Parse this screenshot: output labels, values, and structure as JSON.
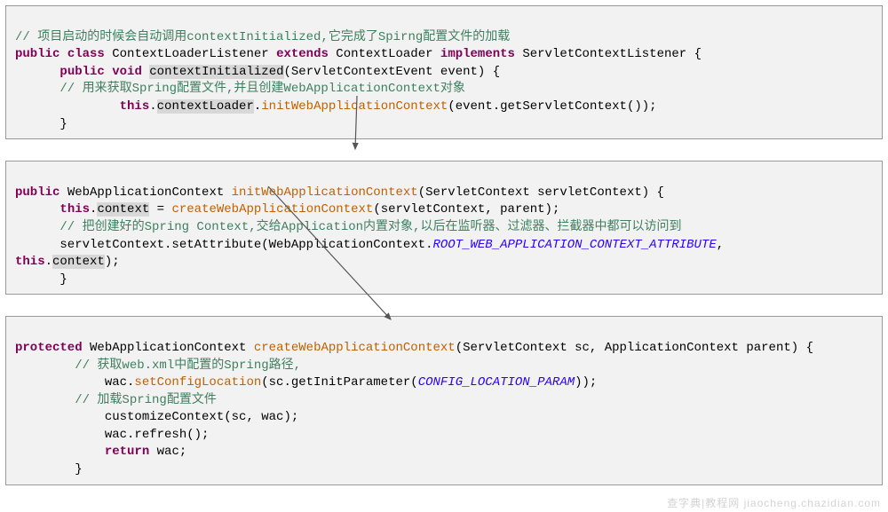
{
  "box1": {
    "c1a": "// 项目启动的时候会自动调用",
    "c1b": "contextInitialized",
    "c1c": ",它完成了Spirng配置文件的加载",
    "l2_kw1": "public",
    "l2_kw2": "class",
    "l2_name": " ContextLoaderListener ",
    "l2_kw3": "extends",
    "l2_mid": " ContextLoader ",
    "l2_kw4": "implements",
    "l2_end": " ServletContextListener {",
    "l3_pad": "      ",
    "l3_kw1": "public",
    "l3_sp": " ",
    "l3_kw2": "void",
    "l3_sp2": " ",
    "l3_hl": "contextInitialized",
    "l3_end": "(ServletContextEvent event) {",
    "c4": "      // 用来获取Spring配置文件,并且创建WebApplicationContext对象",
    "l5_pad": "              ",
    "l5_kw": "this",
    "l5_a": ".",
    "l5_hl": "contextLoader",
    "l5_b": ".",
    "l5_call": "initWebApplicationContext",
    "l5_end": "(event.getServletContext());",
    "l6": "      }"
  },
  "box2": {
    "l1_kw": "public",
    "l1_a": " WebApplicationContext ",
    "l1_call": "initWebApplicationContext",
    "l1_end": "(ServletContext servletContext) {",
    "l2_pad": "      ",
    "l2_kw": "this",
    "l2_a": ".",
    "l2_hl": "context",
    "l2_b": " = ",
    "l2_call": "createWebApplicationContext",
    "l2_end": "(servletContext, parent);",
    "c3": "      // 把创建好的Spring Context,交给Application内置对象,以后在监听器、过滤器、拦截器中都可以访问到",
    "l4_a": "      servletContext.setAttribute(WebApplicationContext.",
    "l4_const": "ROOT_WEB_APPLICATION_CONTEXT_ATTRIBUTE",
    "l4_b": ",",
    "l5_kw": "this",
    "l5_a": ".",
    "l5_hl": "context",
    "l5_b": ");",
    "l6": "      }"
  },
  "box3": {
    "l1_kw": "protected",
    "l1_a": " WebApplicationContext ",
    "l1_call": "createWebApplicationContext",
    "l1_end": "(ServletContext sc, ApplicationContext parent) {",
    "c2": "        // 获取web.xml中配置的Spring路径,",
    "l3_a": "            wac.",
    "l3_call": "setConfigLocation",
    "l3_b": "(sc.getInitParameter(",
    "l3_const": "CONFIG_LOCATION_PARAM",
    "l3_c": "));",
    "c4": "        // 加载Spring配置文件",
    "l5": "            customizeContext(sc, wac);",
    "l6": "            wac.refresh();",
    "l7_pad": "            ",
    "l7_kw": "return",
    "l7_end": " wac;",
    "l8": "        }"
  },
  "watermark": "查字典|教程网  jiaocheng.chazidian.com"
}
